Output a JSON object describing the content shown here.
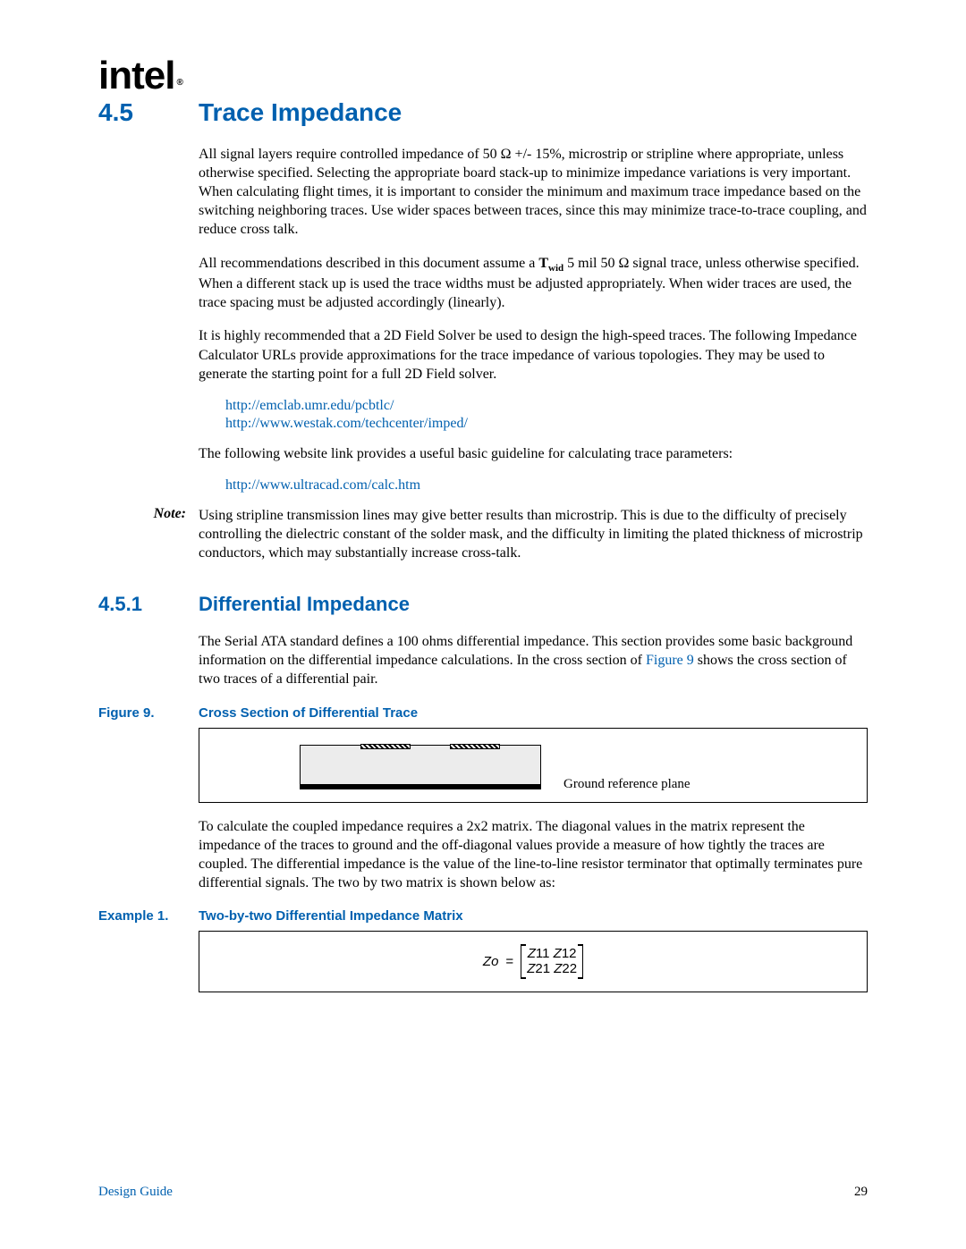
{
  "logo": "intel",
  "section": {
    "num": "4.5",
    "title": "Trace Impedance"
  },
  "p1": "All signal layers require controlled impedance of 50 Ω +/- 15%, microstrip or stripline where appropriate, unless otherwise specified. Selecting the appropriate board stack-up to minimize impedance variations is very important. When calculating flight times, it is important to consider the minimum and maximum trace impedance based on the switching neighboring traces. Use wider spaces between traces, since this may minimize trace-to-trace coupling, and reduce cross talk.",
  "p2_pre": "All recommendations described in this document assume a ",
  "p2_bold": "Twid",
  "p2_post": " 5 mil 50 Ω signal trace, unless otherwise specified. When a different stack up is used the trace widths must be adjusted appropriately. When wider traces are used, the trace spacing must be adjusted accordingly (linearly).",
  "p3": "It is highly recommended that a 2D Field Solver be used to design the high-speed traces. The following Impedance Calculator URLs provide approximations for the trace impedance of various topologies. They may be used to generate the starting point for a full 2D Field solver.",
  "link1": "http://emclab.umr.edu/pcbtlc/",
  "link2": "http://www.westak.com/techcenter/imped/",
  "p4": "The following website link provides a useful basic guideline for calculating trace parameters:",
  "link3": "http://www.ultracad.com/calc.htm",
  "note_label": "Note:",
  "note_text": "Using stripline transmission lines may give better results than microstrip. This is due to the difficulty of precisely controlling the dielectric constant of the solder mask, and the difficulty in limiting the plated thickness of microstrip conductors, which may substantially increase cross-talk.",
  "subsection": {
    "num": "4.5.1",
    "title": "Differential Impedance"
  },
  "p5_pre": "The Serial ATA standard defines a 100 ohms differential impedance. This section provides some basic background information on the differential impedance calculations. In the cross section of ",
  "p5_link": "Figure 9",
  "p5_post": " shows the cross section of two traces of a differential pair.",
  "fig9_label": "Figure 9.",
  "fig9_title": "Cross Section of Differential Trace",
  "fig9_gp": "Ground reference plane",
  "p6": "To calculate the coupled impedance requires a 2x2 matrix. The diagonal values in the matrix represent the impedance of the traces to ground and the off-diagonal values provide a measure of how tightly the traces are coupled. The differential impedance is the value of the line-to-line resistor terminator that optimally terminates pure differential signals. The two by two matrix is shown below as:",
  "ex1_label": "Example 1.",
  "ex1_title": "Two-by-two Differential Impedance Matrix",
  "matrix": {
    "lhs": "Zo",
    "eq": "=",
    "r1c1": "Z11",
    "r1c2": "Z12",
    "r2c1": "Z21",
    "r2c2": "Z22"
  },
  "footer_left": "Design Guide",
  "footer_right": "29"
}
